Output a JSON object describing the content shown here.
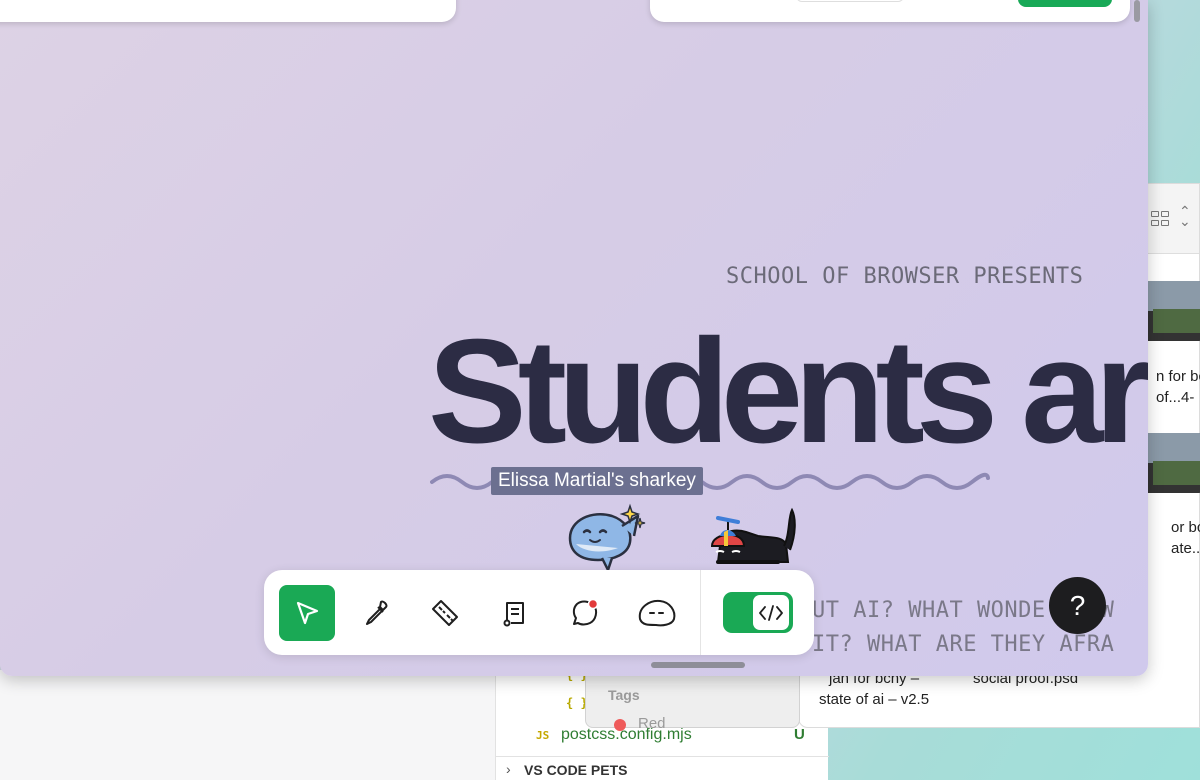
{
  "page": {
    "eyebrow": "SCHOOL OF BROWSER PRESENTS",
    "headline": "Students ar",
    "tooltip": "Elissa Martial's sharkey",
    "body_lines": [
      "UT AI? WHAT WONDE   L, W",
      "  IT? WHAT ARE THEY AFRA"
    ],
    "help_label": "?"
  },
  "toolbar": {
    "tools": [
      {
        "name": "select-tool",
        "icon": "cursor-arrow-icon",
        "active": true
      },
      {
        "name": "eyedropper-tool",
        "icon": "eyedropper-icon",
        "active": false
      },
      {
        "name": "ruler-tool",
        "icon": "ruler-icon",
        "active": false
      },
      {
        "name": "notes-tool",
        "icon": "notes-icon",
        "active": false
      },
      {
        "name": "comment-tool",
        "icon": "comment-bubble-icon",
        "active": false
      },
      {
        "name": "pet-tool",
        "icon": "blob-face-icon",
        "active": false
      }
    ],
    "code_toggle_icon": "code-brackets-icon",
    "code_toggle_on": true,
    "accent": "#1aa955"
  },
  "vscode": {
    "braces": [
      "{ }",
      "{ }"
    ],
    "file_lang": "JS",
    "file_name": "postcss.config.mjs",
    "file_status": "U",
    "section": "VS CODE PETS"
  },
  "finder": {
    "tags_label": "Tags",
    "tag_red": "Red",
    "files": [
      {
        "line1": "jan for bcny –",
        "line2": "state of ai  – v2.5"
      },
      {
        "line1": "social proof.psd",
        "line2": ""
      }
    ],
    "partial_names": [
      {
        "line1": "n for bc",
        "line2": " of...4-"
      },
      {
        "line1": "or bcny",
        "line2": "ate...ai"
      }
    ]
  },
  "colors": {
    "headline": "#2c2c44",
    "tooltip_bg": "#6c7090",
    "help_bg": "#1d1d1f"
  }
}
